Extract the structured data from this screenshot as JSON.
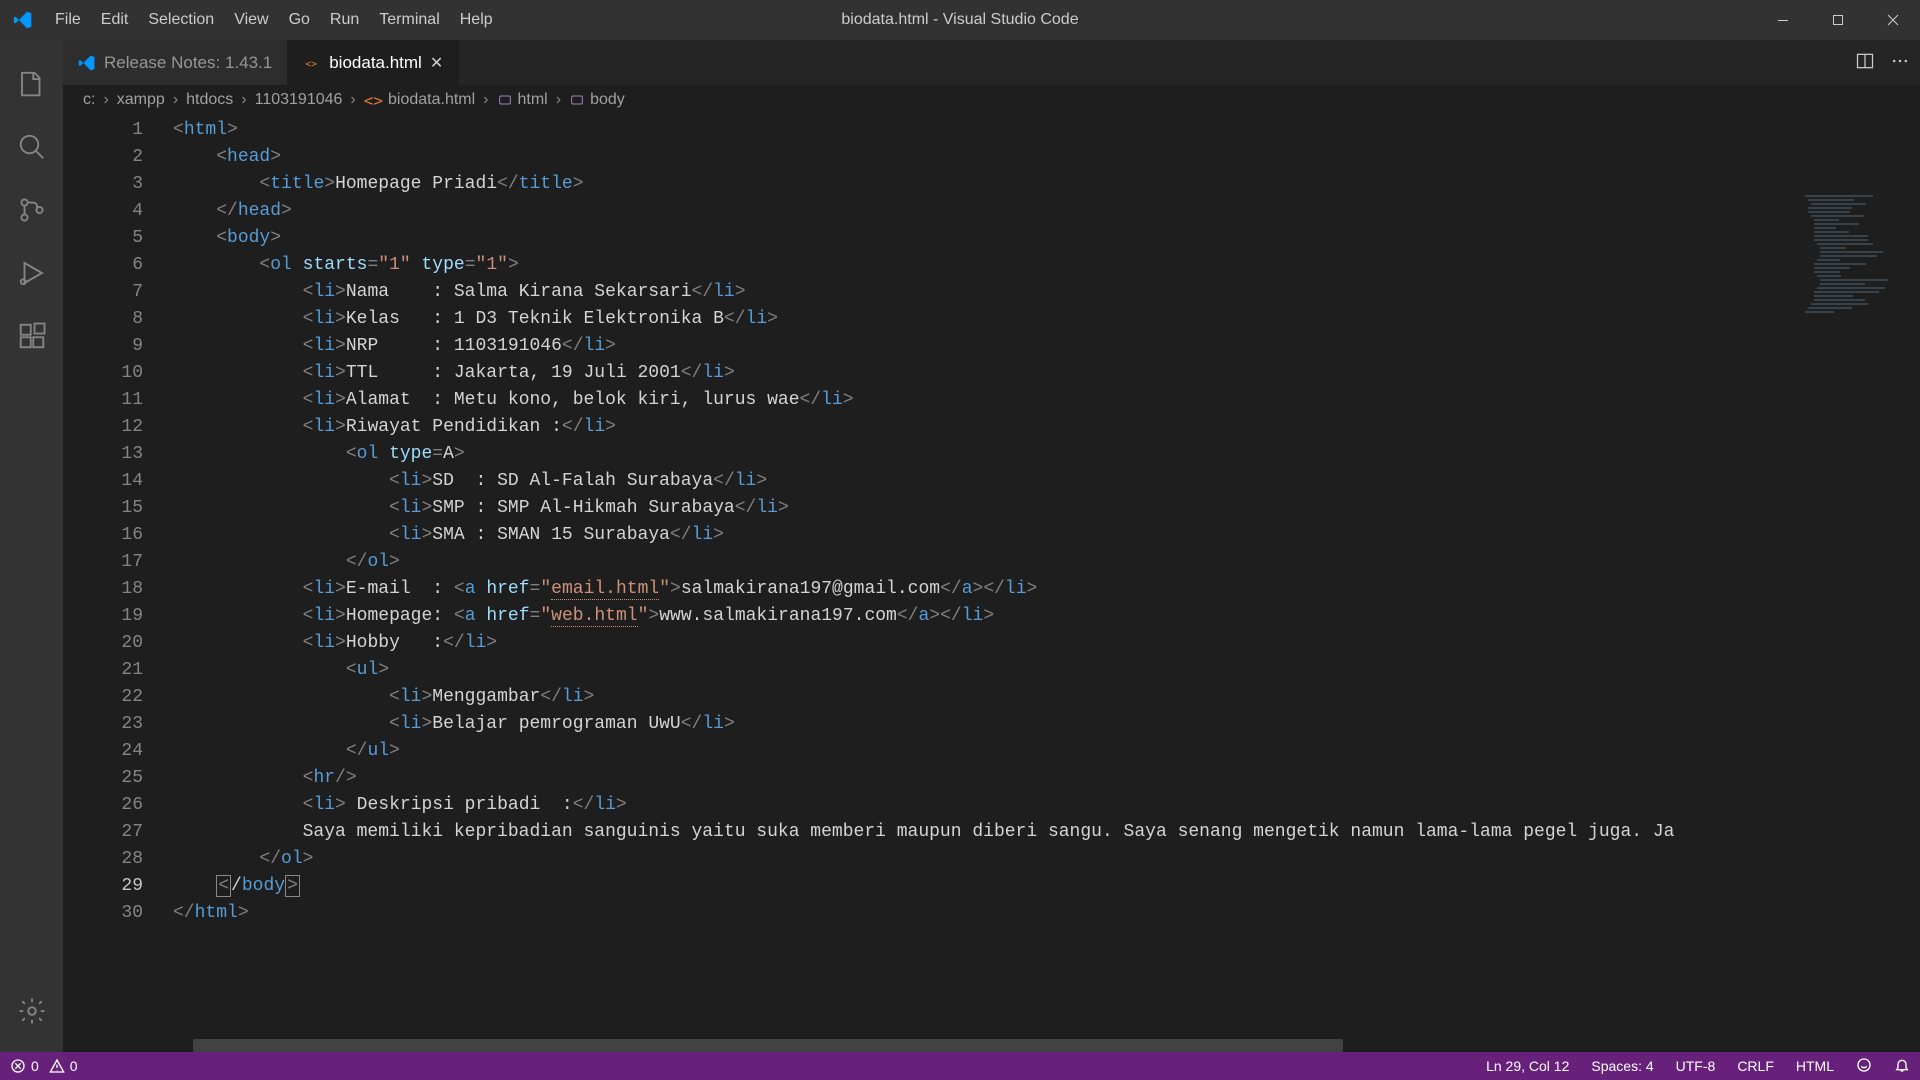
{
  "window": {
    "title": "biodata.html - Visual Studio Code"
  },
  "menu": {
    "items": [
      "File",
      "Edit",
      "Selection",
      "View",
      "Go",
      "Run",
      "Terminal",
      "Help"
    ]
  },
  "tabs": [
    {
      "label": "Release Notes: 1.43.1",
      "active": false,
      "icon": "vscode"
    },
    {
      "label": "biodata.html",
      "active": true,
      "icon": "html"
    }
  ],
  "breadcrumbs": {
    "parts": [
      "c:",
      "xampp",
      "htdocs",
      "1103191046",
      "biodata.html",
      "html",
      "body"
    ]
  },
  "code": {
    "lines": [
      {
        "n": 1,
        "indent": 0,
        "tokens": [
          {
            "t": "punc",
            "v": "<"
          },
          {
            "t": "tag",
            "v": "html"
          },
          {
            "t": "punc",
            "v": ">"
          }
        ]
      },
      {
        "n": 2,
        "indent": 1,
        "tokens": [
          {
            "t": "punc",
            "v": "<"
          },
          {
            "t": "tag",
            "v": "head"
          },
          {
            "t": "punc",
            "v": ">"
          }
        ]
      },
      {
        "n": 3,
        "indent": 2,
        "tokens": [
          {
            "t": "punc",
            "v": "<"
          },
          {
            "t": "tag",
            "v": "title"
          },
          {
            "t": "punc",
            "v": ">"
          },
          {
            "t": "text",
            "v": "Homepage Priadi"
          },
          {
            "t": "punc",
            "v": "</"
          },
          {
            "t": "tag",
            "v": "title"
          },
          {
            "t": "punc",
            "v": ">"
          }
        ]
      },
      {
        "n": 4,
        "indent": 1,
        "tokens": [
          {
            "t": "punc",
            "v": "</"
          },
          {
            "t": "tag",
            "v": "head"
          },
          {
            "t": "punc",
            "v": ">"
          }
        ]
      },
      {
        "n": 5,
        "indent": 1,
        "tokens": [
          {
            "t": "punc",
            "v": "<"
          },
          {
            "t": "tag",
            "v": "body"
          },
          {
            "t": "punc",
            "v": ">"
          }
        ]
      },
      {
        "n": 6,
        "indent": 2,
        "tokens": [
          {
            "t": "punc",
            "v": "<"
          },
          {
            "t": "tag",
            "v": "ol"
          },
          {
            "t": "text",
            "v": " "
          },
          {
            "t": "attr",
            "v": "starts"
          },
          {
            "t": "punc",
            "v": "="
          },
          {
            "t": "val",
            "v": "\"1\""
          },
          {
            "t": "text",
            "v": " "
          },
          {
            "t": "attr",
            "v": "type"
          },
          {
            "t": "punc",
            "v": "="
          },
          {
            "t": "val",
            "v": "\"1\""
          },
          {
            "t": "punc",
            "v": ">"
          }
        ]
      },
      {
        "n": 7,
        "indent": 3,
        "tokens": [
          {
            "t": "punc",
            "v": "<"
          },
          {
            "t": "tag",
            "v": "li"
          },
          {
            "t": "punc",
            "v": ">"
          },
          {
            "t": "text",
            "v": "Nama    : Salma Kirana Sekarsari"
          },
          {
            "t": "punc",
            "v": "</"
          },
          {
            "t": "tag",
            "v": "li"
          },
          {
            "t": "punc",
            "v": ">"
          }
        ]
      },
      {
        "n": 8,
        "indent": 3,
        "tokens": [
          {
            "t": "punc",
            "v": "<"
          },
          {
            "t": "tag",
            "v": "li"
          },
          {
            "t": "punc",
            "v": ">"
          },
          {
            "t": "text",
            "v": "Kelas   : 1 D3 Teknik Elektronika B"
          },
          {
            "t": "punc",
            "v": "</"
          },
          {
            "t": "tag",
            "v": "li"
          },
          {
            "t": "punc",
            "v": ">"
          }
        ]
      },
      {
        "n": 9,
        "indent": 3,
        "tokens": [
          {
            "t": "punc",
            "v": "<"
          },
          {
            "t": "tag",
            "v": "li"
          },
          {
            "t": "punc",
            "v": ">"
          },
          {
            "t": "text",
            "v": "NRP     : 1103191046"
          },
          {
            "t": "punc",
            "v": "</"
          },
          {
            "t": "tag",
            "v": "li"
          },
          {
            "t": "punc",
            "v": ">"
          }
        ]
      },
      {
        "n": 10,
        "indent": 3,
        "tokens": [
          {
            "t": "punc",
            "v": "<"
          },
          {
            "t": "tag",
            "v": "li"
          },
          {
            "t": "punc",
            "v": ">"
          },
          {
            "t": "text",
            "v": "TTL     : Jakarta, 19 Juli 2001"
          },
          {
            "t": "punc",
            "v": "</"
          },
          {
            "t": "tag",
            "v": "li"
          },
          {
            "t": "punc",
            "v": ">"
          }
        ]
      },
      {
        "n": 11,
        "indent": 3,
        "tokens": [
          {
            "t": "punc",
            "v": "<"
          },
          {
            "t": "tag",
            "v": "li"
          },
          {
            "t": "punc",
            "v": ">"
          },
          {
            "t": "text",
            "v": "Alamat  : Metu kono, belok kiri, lurus wae"
          },
          {
            "t": "punc",
            "v": "</"
          },
          {
            "t": "tag",
            "v": "li"
          },
          {
            "t": "punc",
            "v": ">"
          }
        ]
      },
      {
        "n": 12,
        "indent": 3,
        "tokens": [
          {
            "t": "punc",
            "v": "<"
          },
          {
            "t": "tag",
            "v": "li"
          },
          {
            "t": "punc",
            "v": ">"
          },
          {
            "t": "text",
            "v": "Riwayat Pendidikan :"
          },
          {
            "t": "punc",
            "v": "</"
          },
          {
            "t": "tag",
            "v": "li"
          },
          {
            "t": "punc",
            "v": ">"
          }
        ]
      },
      {
        "n": 13,
        "indent": 4,
        "tokens": [
          {
            "t": "punc",
            "v": "<"
          },
          {
            "t": "tag",
            "v": "ol"
          },
          {
            "t": "text",
            "v": " "
          },
          {
            "t": "attr",
            "v": "type"
          },
          {
            "t": "punc",
            "v": "="
          },
          {
            "t": "text",
            "v": "A"
          },
          {
            "t": "punc",
            "v": ">"
          }
        ]
      },
      {
        "n": 14,
        "indent": 5,
        "tokens": [
          {
            "t": "punc",
            "v": "<"
          },
          {
            "t": "tag",
            "v": "li"
          },
          {
            "t": "punc",
            "v": ">"
          },
          {
            "t": "text",
            "v": "SD  : SD Al-Falah Surabaya"
          },
          {
            "t": "punc",
            "v": "</"
          },
          {
            "t": "tag",
            "v": "li"
          },
          {
            "t": "punc",
            "v": ">"
          }
        ]
      },
      {
        "n": 15,
        "indent": 5,
        "tokens": [
          {
            "t": "punc",
            "v": "<"
          },
          {
            "t": "tag",
            "v": "li"
          },
          {
            "t": "punc",
            "v": ">"
          },
          {
            "t": "text",
            "v": "SMP : SMP Al-Hikmah Surabaya"
          },
          {
            "t": "punc",
            "v": "</"
          },
          {
            "t": "tag",
            "v": "li"
          },
          {
            "t": "punc",
            "v": ">"
          }
        ]
      },
      {
        "n": 16,
        "indent": 5,
        "tokens": [
          {
            "t": "punc",
            "v": "<"
          },
          {
            "t": "tag",
            "v": "li"
          },
          {
            "t": "punc",
            "v": ">"
          },
          {
            "t": "text",
            "v": "SMA : SMAN 15 Surabaya"
          },
          {
            "t": "punc",
            "v": "</"
          },
          {
            "t": "tag",
            "v": "li"
          },
          {
            "t": "punc",
            "v": ">"
          }
        ]
      },
      {
        "n": 17,
        "indent": 4,
        "tokens": [
          {
            "t": "punc",
            "v": "</"
          },
          {
            "t": "tag",
            "v": "ol"
          },
          {
            "t": "punc",
            "v": ">"
          }
        ]
      },
      {
        "n": 18,
        "indent": 3,
        "tokens": [
          {
            "t": "punc",
            "v": "<"
          },
          {
            "t": "tag",
            "v": "li"
          },
          {
            "t": "punc",
            "v": ">"
          },
          {
            "t": "text",
            "v": "E-mail  : "
          },
          {
            "t": "punc",
            "v": "<"
          },
          {
            "t": "tag",
            "v": "a"
          },
          {
            "t": "text",
            "v": " "
          },
          {
            "t": "attr",
            "v": "href"
          },
          {
            "t": "punc",
            "v": "="
          },
          {
            "t": "val",
            "v": "\""
          },
          {
            "t": "valU",
            "v": "email.html"
          },
          {
            "t": "val",
            "v": "\""
          },
          {
            "t": "punc",
            "v": ">"
          },
          {
            "t": "text",
            "v": "salmakirana197@gmail.com"
          },
          {
            "t": "punc",
            "v": "</"
          },
          {
            "t": "tag",
            "v": "a"
          },
          {
            "t": "punc",
            "v": ">"
          },
          {
            "t": "punc",
            "v": "</"
          },
          {
            "t": "tag",
            "v": "li"
          },
          {
            "t": "punc",
            "v": ">"
          }
        ]
      },
      {
        "n": 19,
        "indent": 3,
        "tokens": [
          {
            "t": "punc",
            "v": "<"
          },
          {
            "t": "tag",
            "v": "li"
          },
          {
            "t": "punc",
            "v": ">"
          },
          {
            "t": "text",
            "v": "Homepage: "
          },
          {
            "t": "punc",
            "v": "<"
          },
          {
            "t": "tag",
            "v": "a"
          },
          {
            "t": "text",
            "v": " "
          },
          {
            "t": "attr",
            "v": "href"
          },
          {
            "t": "punc",
            "v": "="
          },
          {
            "t": "val",
            "v": "\""
          },
          {
            "t": "valU",
            "v": "web.html"
          },
          {
            "t": "val",
            "v": "\""
          },
          {
            "t": "punc",
            "v": ">"
          },
          {
            "t": "text",
            "v": "www.salmakirana197.com"
          },
          {
            "t": "punc",
            "v": "</"
          },
          {
            "t": "tag",
            "v": "a"
          },
          {
            "t": "punc",
            "v": ">"
          },
          {
            "t": "punc",
            "v": "</"
          },
          {
            "t": "tag",
            "v": "li"
          },
          {
            "t": "punc",
            "v": ">"
          }
        ]
      },
      {
        "n": 20,
        "indent": 3,
        "tokens": [
          {
            "t": "punc",
            "v": "<"
          },
          {
            "t": "tag",
            "v": "li"
          },
          {
            "t": "punc",
            "v": ">"
          },
          {
            "t": "text",
            "v": "Hobby   :"
          },
          {
            "t": "punc",
            "v": "</"
          },
          {
            "t": "tag",
            "v": "li"
          },
          {
            "t": "punc",
            "v": ">"
          }
        ]
      },
      {
        "n": 21,
        "indent": 4,
        "tokens": [
          {
            "t": "punc",
            "v": "<"
          },
          {
            "t": "tag",
            "v": "ul"
          },
          {
            "t": "punc",
            "v": ">"
          }
        ]
      },
      {
        "n": 22,
        "indent": 5,
        "tokens": [
          {
            "t": "punc",
            "v": "<"
          },
          {
            "t": "tag",
            "v": "li"
          },
          {
            "t": "punc",
            "v": ">"
          },
          {
            "t": "text",
            "v": "Menggambar"
          },
          {
            "t": "punc",
            "v": "</"
          },
          {
            "t": "tag",
            "v": "li"
          },
          {
            "t": "punc",
            "v": ">"
          }
        ]
      },
      {
        "n": 23,
        "indent": 5,
        "tokens": [
          {
            "t": "punc",
            "v": "<"
          },
          {
            "t": "tag",
            "v": "li"
          },
          {
            "t": "punc",
            "v": ">"
          },
          {
            "t": "text",
            "v": "Belajar pemrograman UwU"
          },
          {
            "t": "punc",
            "v": "</"
          },
          {
            "t": "tag",
            "v": "li"
          },
          {
            "t": "punc",
            "v": ">"
          }
        ]
      },
      {
        "n": 24,
        "indent": 4,
        "tokens": [
          {
            "t": "punc",
            "v": "</"
          },
          {
            "t": "tag",
            "v": "ul"
          },
          {
            "t": "punc",
            "v": ">"
          }
        ]
      },
      {
        "n": 25,
        "indent": 3,
        "tokens": [
          {
            "t": "punc",
            "v": "<"
          },
          {
            "t": "tag",
            "v": "hr"
          },
          {
            "t": "punc",
            "v": "/>"
          }
        ]
      },
      {
        "n": 26,
        "indent": 3,
        "tokens": [
          {
            "t": "punc",
            "v": "<"
          },
          {
            "t": "tag",
            "v": "li"
          },
          {
            "t": "punc",
            "v": ">"
          },
          {
            "t": "text",
            "v": " Deskripsi pribadi  :"
          },
          {
            "t": "punc",
            "v": "</"
          },
          {
            "t": "tag",
            "v": "li"
          },
          {
            "t": "punc",
            "v": ">"
          }
        ]
      },
      {
        "n": 27,
        "indent": 3,
        "tokens": [
          {
            "t": "text",
            "v": "Saya memiliki kepribadian sanguinis yaitu suka memberi maupun diberi sangu. Saya senang mengetik namun lama-lama pegel juga. Ja"
          }
        ]
      },
      {
        "n": 28,
        "indent": 2,
        "tokens": [
          {
            "t": "punc",
            "v": "</"
          },
          {
            "t": "tag",
            "v": "ol"
          },
          {
            "t": "punc",
            "v": ">"
          }
        ]
      },
      {
        "n": 29,
        "indent": 1,
        "tokens": [
          {
            "t": "boxPunc",
            "v": "<"
          },
          {
            "t": "text",
            "v": "/"
          },
          {
            "t": "tag",
            "v": "body"
          },
          {
            "t": "boxPunc",
            "v": ">"
          }
        ],
        "active": true
      },
      {
        "n": 30,
        "indent": 0,
        "tokens": [
          {
            "t": "punc",
            "v": "</"
          },
          {
            "t": "tag",
            "v": "html"
          },
          {
            "t": "punc",
            "v": ">"
          }
        ]
      }
    ]
  },
  "status": {
    "errors": "0",
    "warnings": "0",
    "position": "Ln 29, Col 12",
    "spaces": "Spaces: 4",
    "encoding": "UTF-8",
    "eol": "CRLF",
    "language": "HTML"
  }
}
